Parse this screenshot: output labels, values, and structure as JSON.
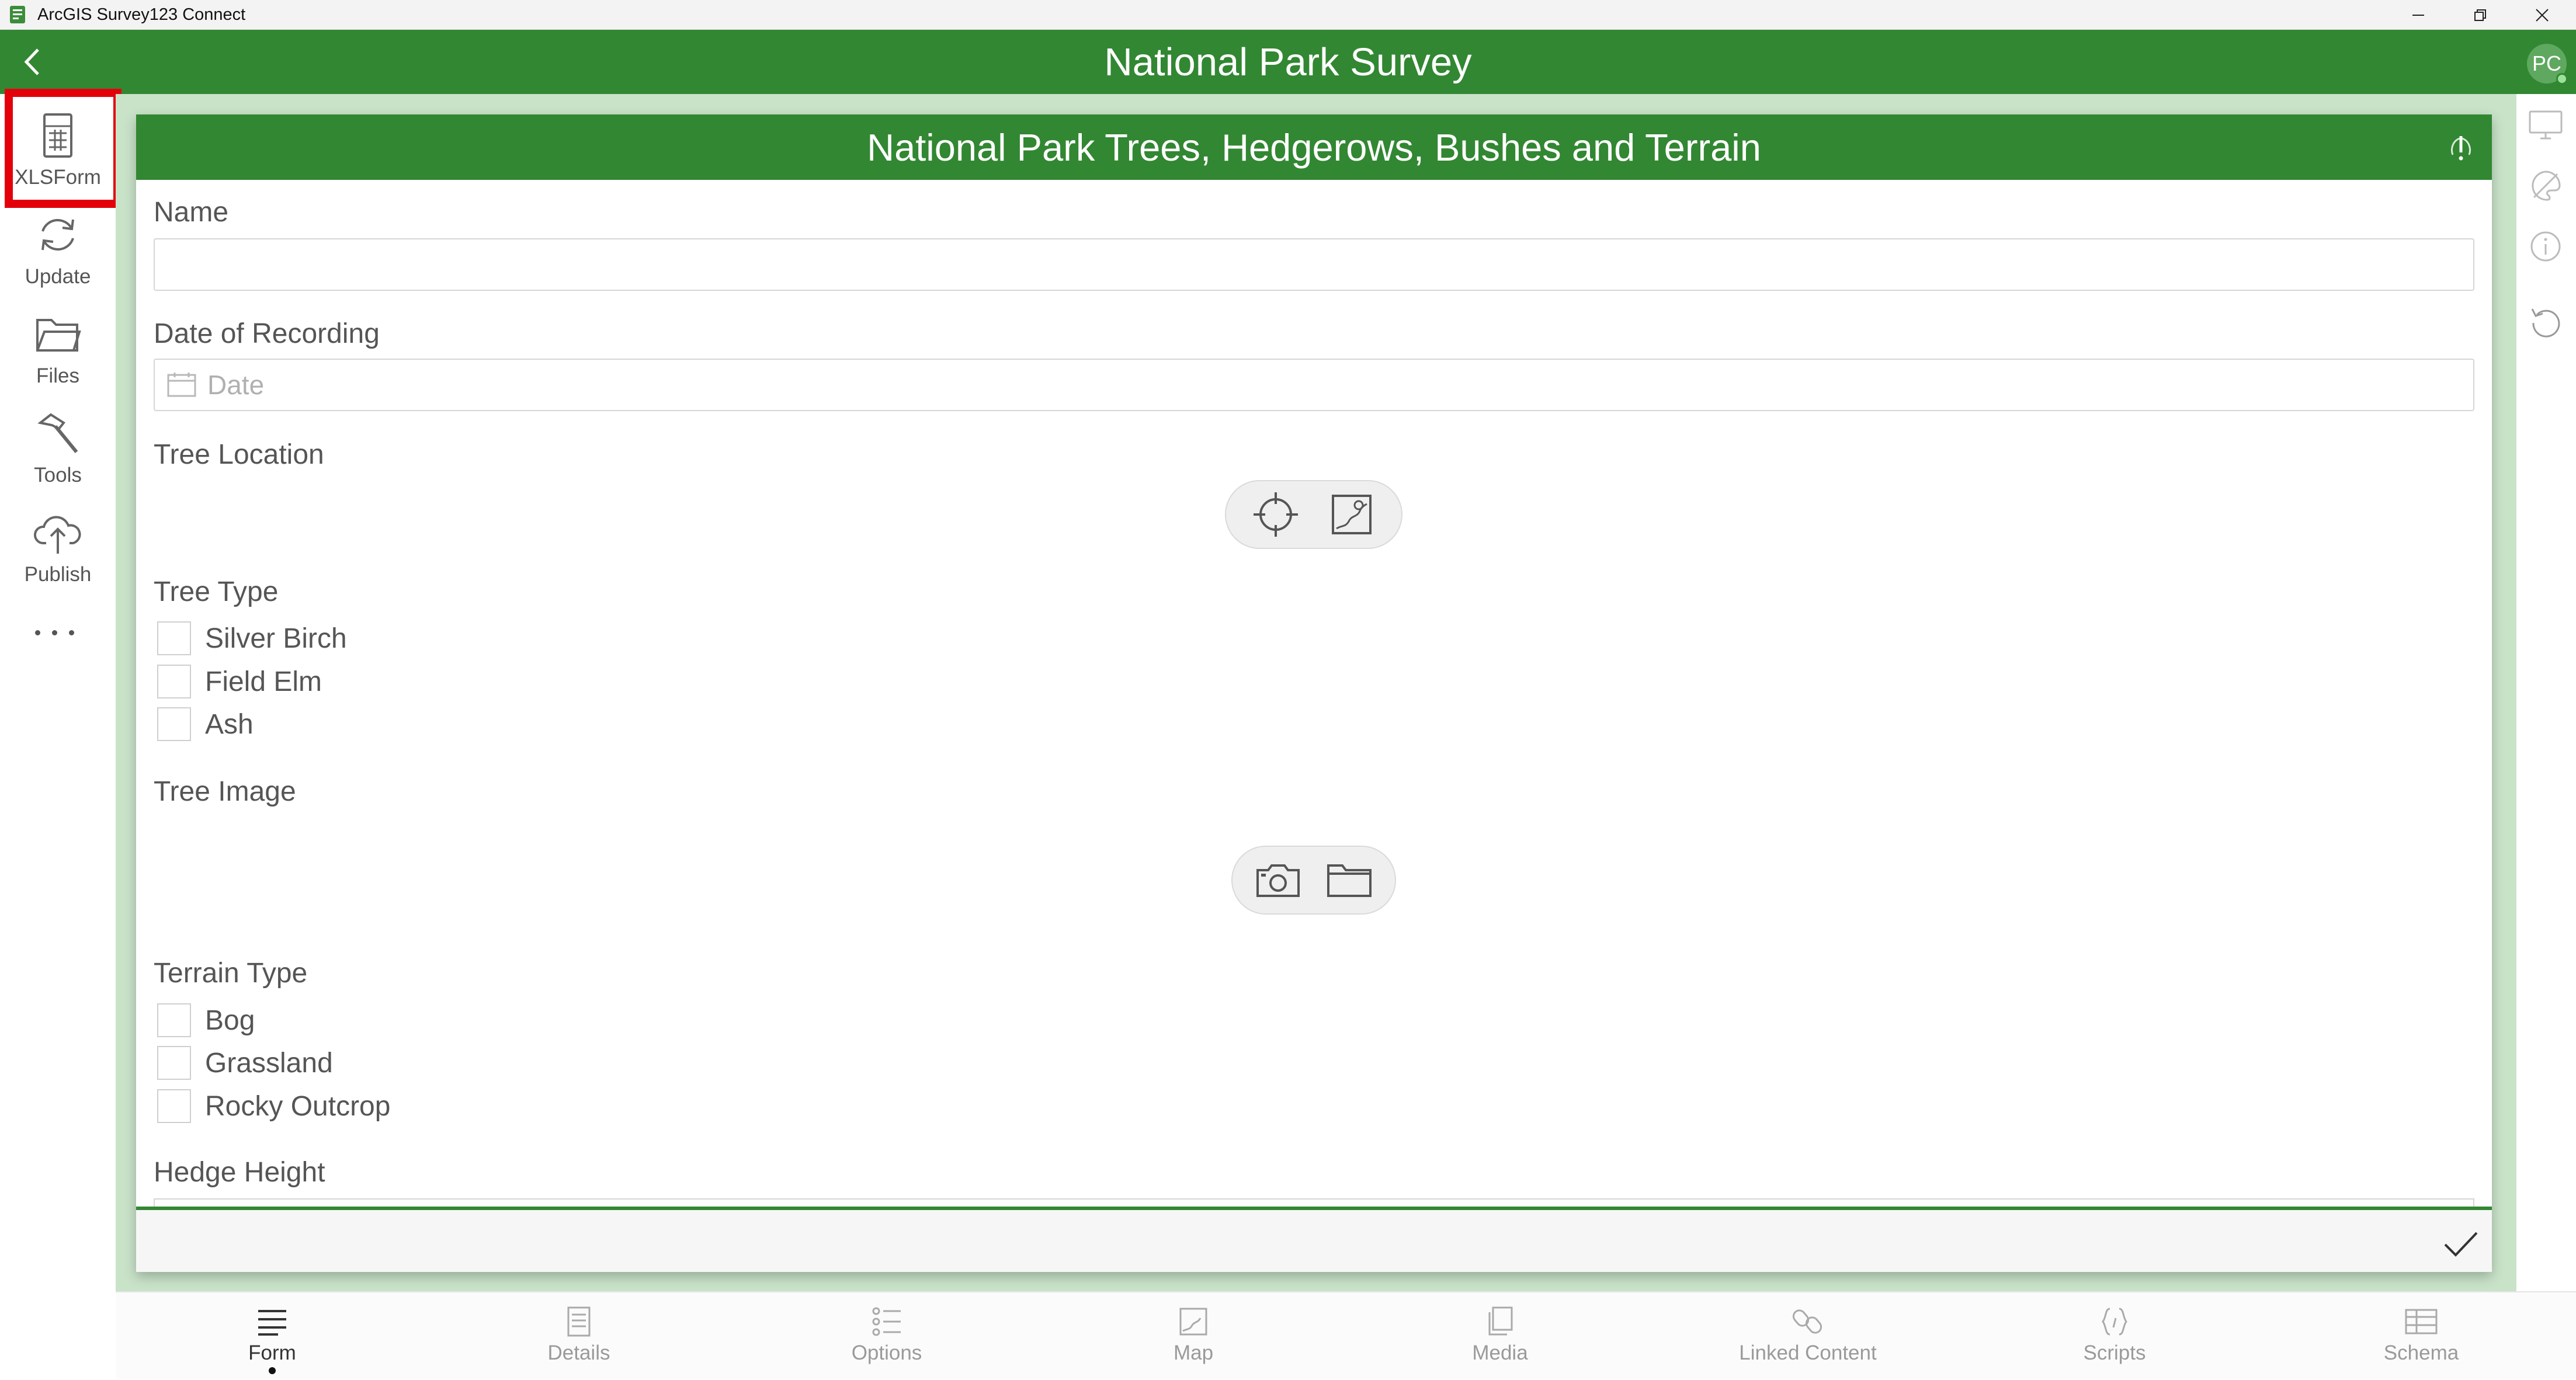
{
  "window": {
    "app_title": "ArcGIS Survey123 Connect",
    "minimize_icon": "minimize-icon",
    "restore_icon": "restore-icon",
    "close_icon": "close-icon"
  },
  "header": {
    "title": "National Park Survey",
    "avatar_initials": "PC"
  },
  "sidebar": {
    "items": [
      {
        "label": "XLSForm",
        "icon": "spreadsheet-icon"
      },
      {
        "label": "Update",
        "icon": "refresh-icon"
      },
      {
        "label": "Files",
        "icon": "folder-icon"
      },
      {
        "label": "Tools",
        "icon": "hammer-icon"
      },
      {
        "label": "Publish",
        "icon": "cloud-upload-icon"
      }
    ],
    "more_icon": "more-icon"
  },
  "form": {
    "title": "National Park Trees, Hedgerows, Bushes and Terrain",
    "questions": {
      "name": {
        "label": "Name",
        "value": ""
      },
      "date": {
        "label": "Date of Recording",
        "placeholder": "Date"
      },
      "location": {
        "label": "Tree Location"
      },
      "tree_type": {
        "label": "Tree Type",
        "options": [
          "Silver Birch",
          "Field Elm",
          "Ash"
        ]
      },
      "tree_image": {
        "label": "Tree Image"
      },
      "terrain_type": {
        "label": "Terrain Type",
        "options": [
          "Bog",
          "Grassland",
          "Rocky Outcrop"
        ]
      },
      "hedge_height": {
        "label": "Hedge Height"
      }
    }
  },
  "bottom_tabs": [
    {
      "label": "Form",
      "icon": "form-icon",
      "active": true
    },
    {
      "label": "Details",
      "icon": "details-icon"
    },
    {
      "label": "Options",
      "icon": "options-icon"
    },
    {
      "label": "Map",
      "icon": "map-icon"
    },
    {
      "label": "Media",
      "icon": "media-icon"
    },
    {
      "label": "Linked Content",
      "icon": "link-icon"
    },
    {
      "label": "Scripts",
      "icon": "scripts-icon"
    },
    {
      "label": "Schema",
      "icon": "schema-icon"
    }
  ],
  "colors": {
    "header_green": "#328732",
    "background_green": "#c9e3c9",
    "highlight_red": "#e3000b"
  }
}
